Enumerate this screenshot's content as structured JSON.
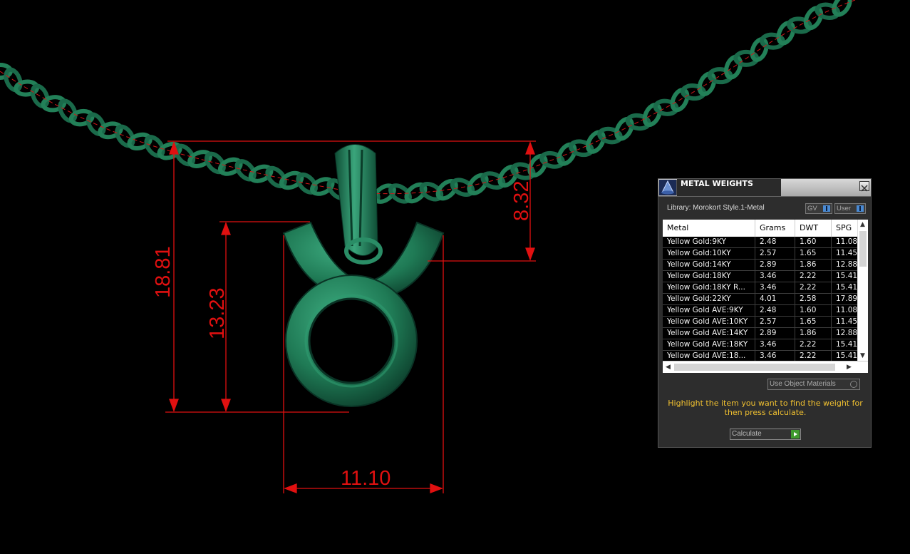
{
  "viewport": {
    "dimensions": {
      "total_height": "18.81",
      "pendant_height": "13.23",
      "bail_height": "8.32",
      "width": "11.10"
    },
    "colors": {
      "metal": "#1f6e4d",
      "dimension": "#e01010",
      "background": "#000000"
    }
  },
  "panel": {
    "title": "METAL WEIGHTS",
    "library": "Library: Morokort Style.1-Metal",
    "toggles": {
      "gv": "GV",
      "user": "User"
    },
    "table": {
      "columns": [
        "Metal",
        "Grams",
        "DWT",
        "SPG"
      ],
      "rows": [
        [
          "Yellow Gold:9KY",
          "2.48",
          "1.60",
          "11.08"
        ],
        [
          "Yellow Gold:10KY",
          "2.57",
          "1.65",
          "11.45"
        ],
        [
          "Yellow Gold:14KY",
          "2.89",
          "1.86",
          "12.88"
        ],
        [
          "Yellow Gold:18KY",
          "3.46",
          "2.22",
          "15.41"
        ],
        [
          "Yellow Gold:18KY R...",
          "3.46",
          "2.22",
          "15.41"
        ],
        [
          "Yellow Gold:22KY",
          "4.01",
          "2.58",
          "17.89"
        ],
        [
          "Yellow Gold AVE:9KY",
          "2.48",
          "1.60",
          "11.08"
        ],
        [
          "Yellow Gold AVE:10KY",
          "2.57",
          "1.65",
          "11.45"
        ],
        [
          "Yellow Gold AVE:14KY",
          "2.89",
          "1.86",
          "12.88"
        ],
        [
          "Yellow Gold AVE:18KY",
          "3.46",
          "2.22",
          "15.41"
        ],
        [
          "Yellow Gold AVE:18...",
          "3.46",
          "2.22",
          "15.41"
        ]
      ]
    },
    "use_object_materials": "Use Object Materials",
    "hint": "Highlight the item you want to find the weight for then press calculate.",
    "calculate": "Calculate",
    "accent": "#f0c030"
  }
}
